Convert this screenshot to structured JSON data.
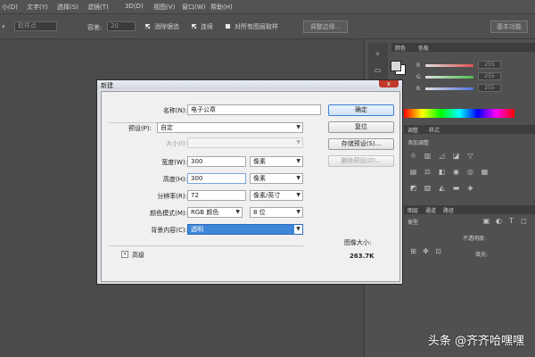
{
  "menu": {
    "left_label": "小(D)",
    "items": [
      "文字(Y)",
      "选择(S)",
      "滤镜(T)",
      "3D(D)",
      "视图(V)",
      "窗口(W)",
      "帮助(H)"
    ]
  },
  "options_bar": {
    "sample_field": "取样点",
    "tolerance_label": "容差:",
    "tolerance_value": "20",
    "antialias_label": "消除锯齿",
    "contiguous_label": "连续",
    "all_layers_label": "对所有图层取样",
    "refine_edge_label": "调整边缘...",
    "workspace_label": "基本功能"
  },
  "right_panel": {
    "color_tabs": [
      "颜色",
      "色板"
    ],
    "color_channels": [
      {
        "name": "R",
        "value": "255",
        "color": "#e05050"
      },
      {
        "name": "G",
        "value": "255",
        "color": "#50c050"
      },
      {
        "name": "B",
        "value": "255",
        "color": "#5070e0"
      }
    ],
    "adjust_tabs": [
      "调整",
      "样式"
    ],
    "adjust_subtitle": "添加调整",
    "layers_tabs": [
      "图层",
      "通道",
      "路径"
    ],
    "layers_kind": "类型",
    "layers_opacity": "不透明度:",
    "layers_fill": "填充:"
  },
  "dialog": {
    "title": "新建",
    "close_label": "x",
    "name_label": "名称(N):",
    "name_value": "电子公章",
    "preset_label": "预设(P):",
    "preset_value": "自定",
    "size_label": "大小(I):",
    "size_value": "",
    "width_label": "宽度(W):",
    "width_value": "300",
    "width_unit": "像素",
    "height_label": "高度(H):",
    "height_value": "300",
    "height_unit": "像素",
    "resolution_label": "分辨率(R):",
    "resolution_value": "72",
    "resolution_unit": "像素/英寸",
    "color_mode_label": "颜色模式(M):",
    "color_mode_value": "RGB 颜色",
    "bit_depth_value": "8 位",
    "background_label": "背景内容(C):",
    "background_value": "透明",
    "advanced_label": "高级",
    "ok_label": "确定",
    "reset_label": "复位",
    "save_preset_label": "存储预设(S)...",
    "delete_preset_label": "删除预设(D)...",
    "image_size_label": "图像大小:",
    "image_size_value": "263.7K"
  },
  "watermark": "头条 @齐齐哈嘿嘿"
}
